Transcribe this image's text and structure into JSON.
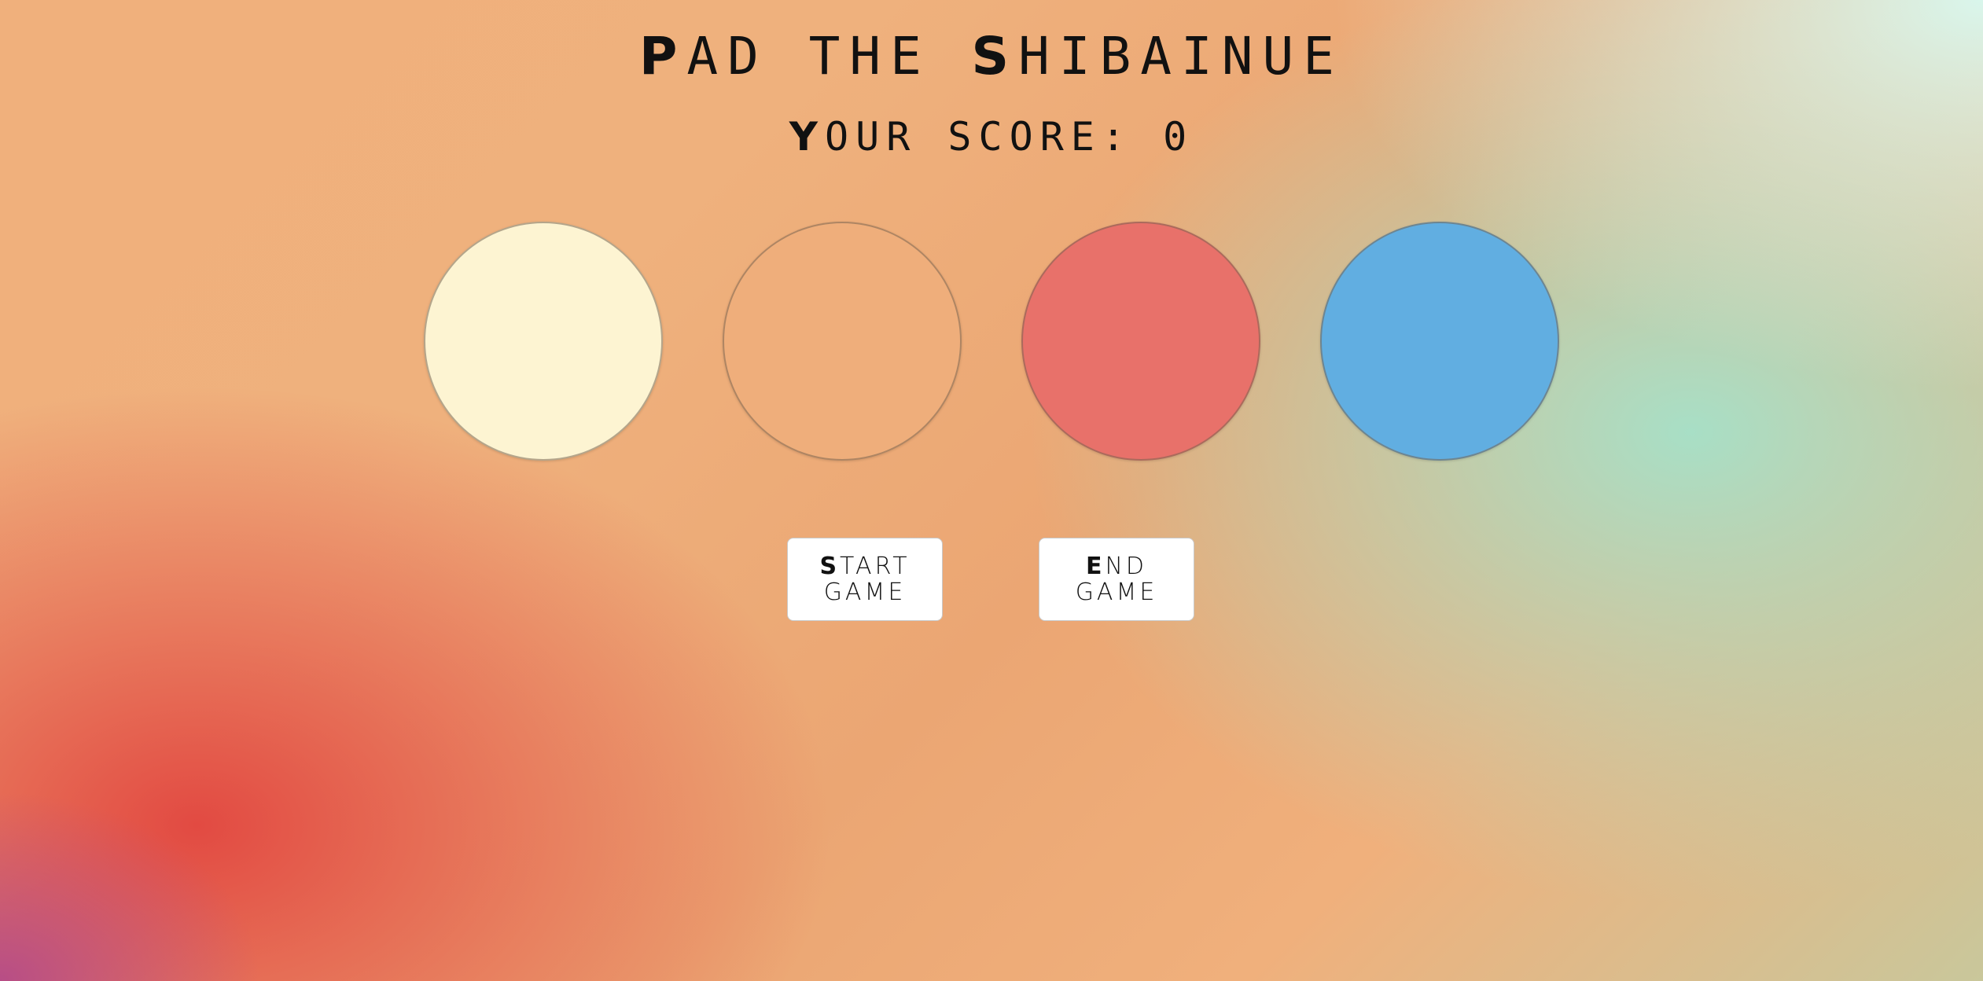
{
  "title": {
    "first_initial": "P",
    "first_rest": "AD THE ",
    "second_initial": "S",
    "second_rest": "HIBAINUE"
  },
  "score": {
    "label_initial": "Y",
    "label_rest": "OUR SCORE: ",
    "value": "0"
  },
  "pads": [
    {
      "color": "#fdf4d2"
    },
    {
      "color": "#efae7b"
    },
    {
      "color": "#e8716a"
    },
    {
      "color": "#61aee1"
    }
  ],
  "controls": {
    "start": {
      "initial": "S",
      "line1_rest": "TART",
      "line2": "GAME"
    },
    "end": {
      "initial": "E",
      "line1_rest": "ND",
      "line2": "GAME"
    }
  }
}
